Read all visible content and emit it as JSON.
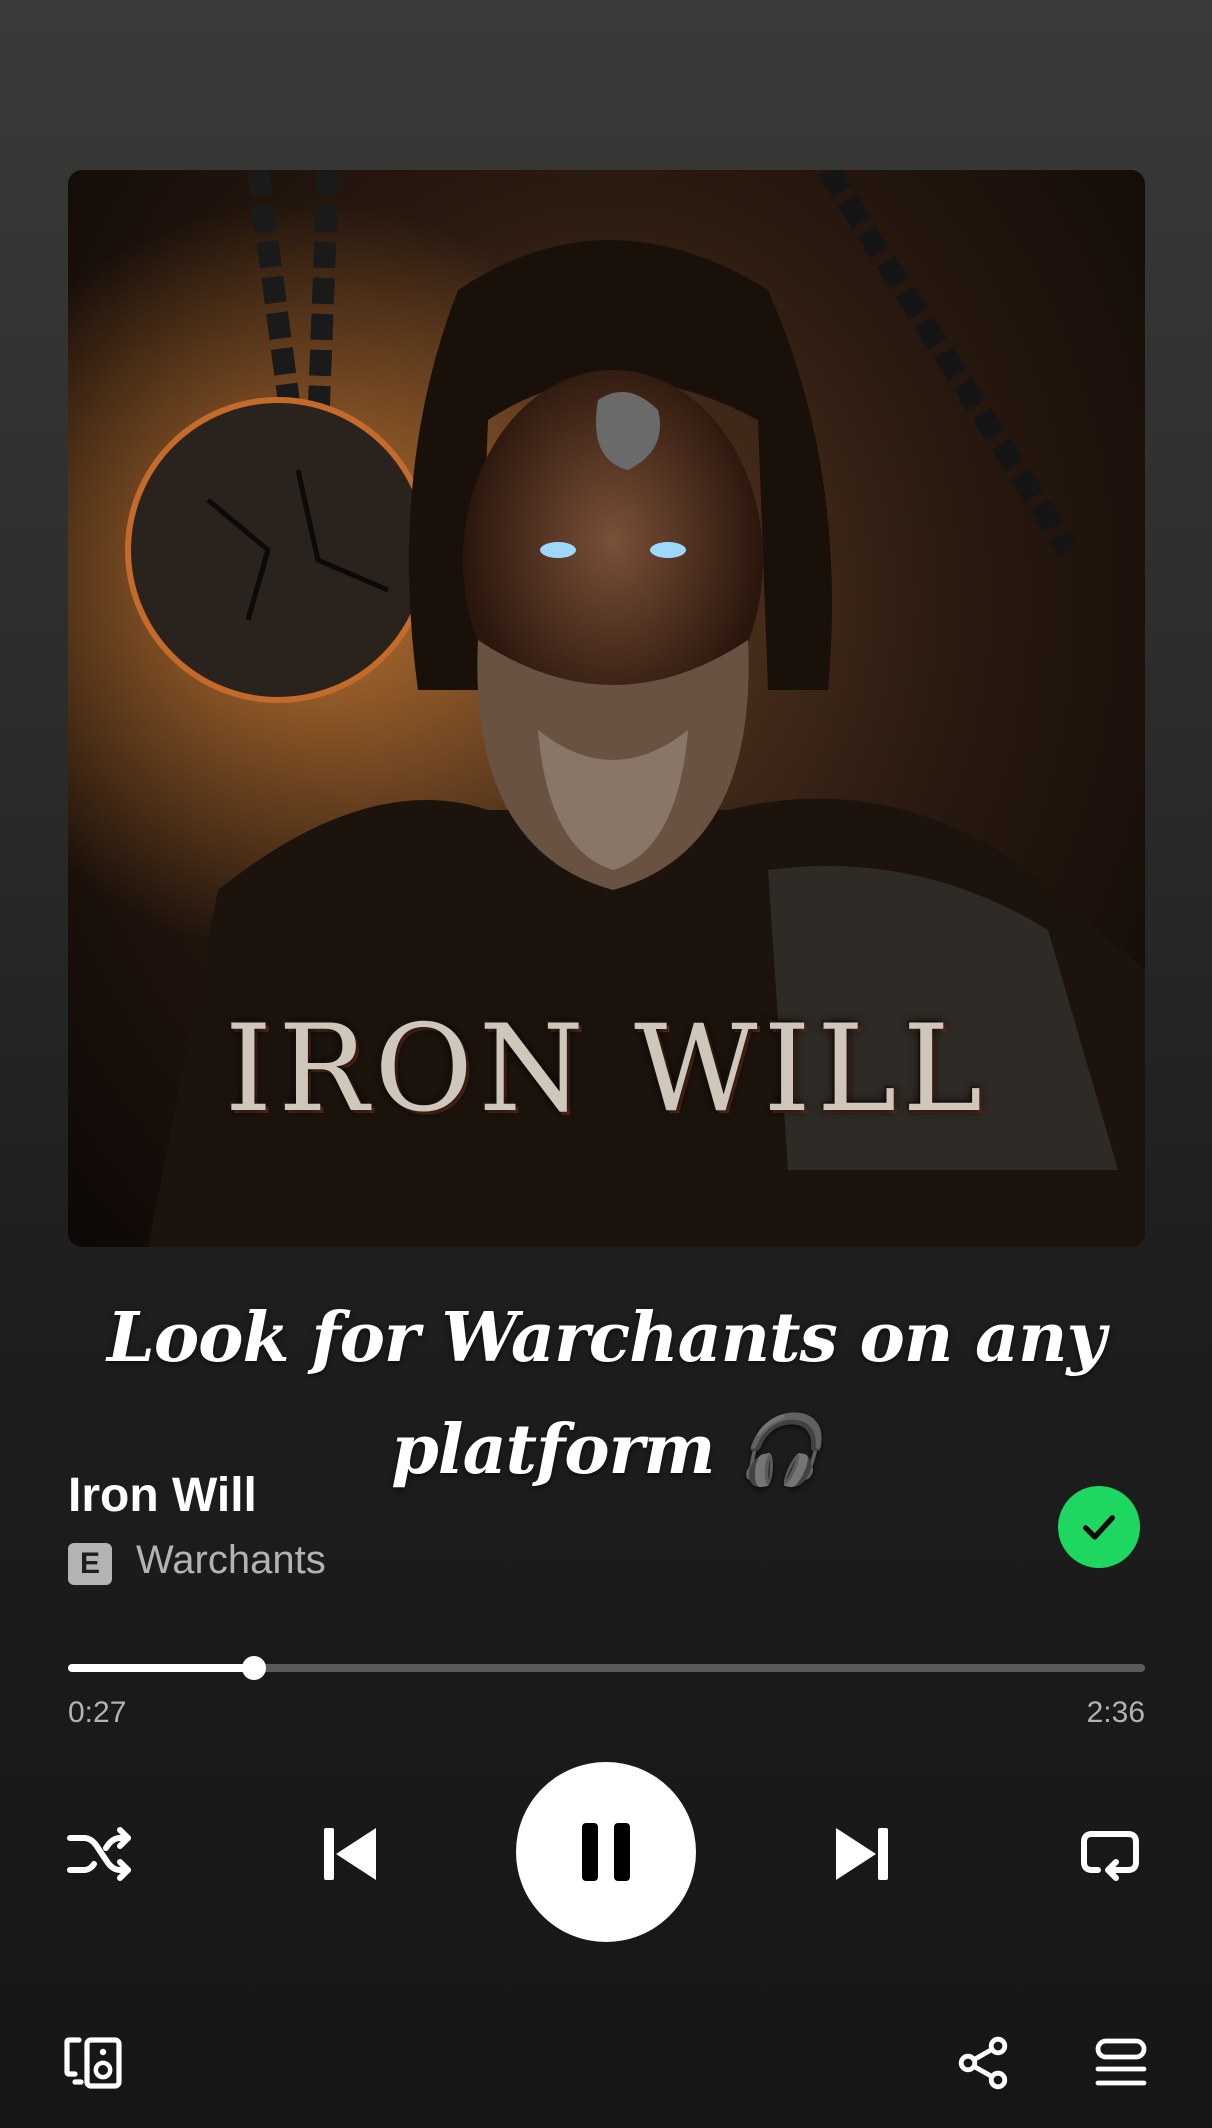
{
  "album_art": {
    "title_text": "IRON WILL"
  },
  "caption": {
    "line1": "Look for Warchants on any",
    "line2": "platform 🎧"
  },
  "track": {
    "title": "Iron Will",
    "explicit_badge": "E",
    "artist": "Warchants"
  },
  "playback": {
    "elapsed": "0:27",
    "duration": "2:36",
    "progress_fraction": 0.173
  },
  "controls": {
    "shuffle_icon": "shuffle-icon",
    "previous_icon": "skip-previous-icon",
    "play_pause_icon": "pause-icon",
    "next_icon": "skip-next-icon",
    "repeat_icon": "repeat-icon"
  },
  "bottom_bar": {
    "devices_icon": "connect-device-icon",
    "share_icon": "share-icon",
    "queue_icon": "queue-icon"
  },
  "colors": {
    "accent": "#1ed760",
    "secondary_text": "#b3b3b3"
  }
}
